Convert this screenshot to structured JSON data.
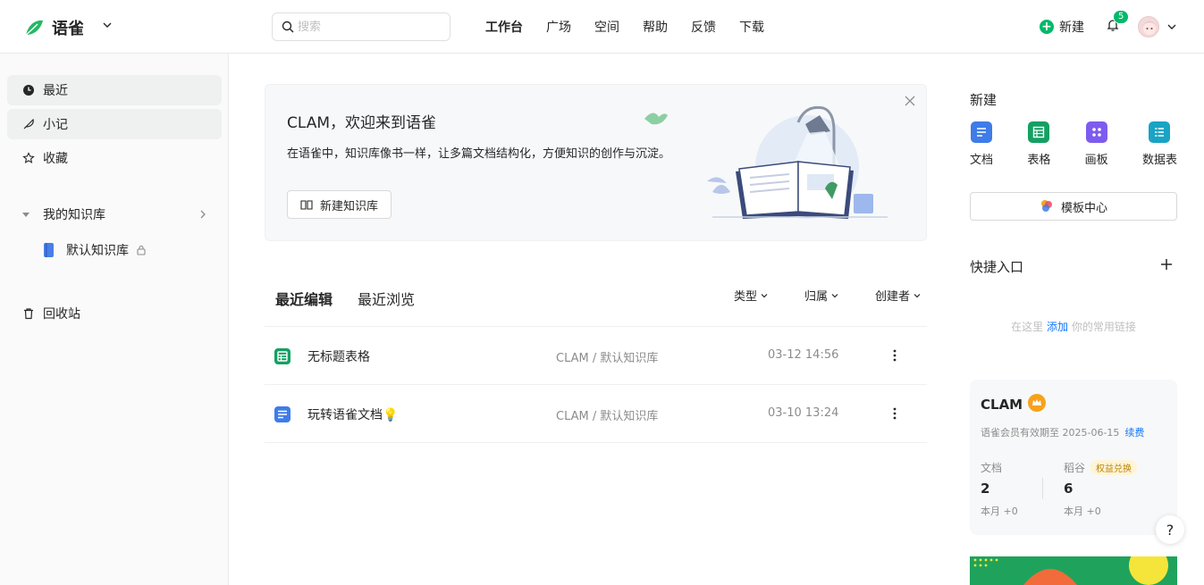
{
  "header": {
    "brand": "语雀",
    "search_placeholder": "搜索",
    "nav": [
      "工作台",
      "广场",
      "空间",
      "帮助",
      "反馈",
      "下载"
    ],
    "new_label": "新建",
    "notification_count": "5"
  },
  "sidebar": {
    "items": [
      {
        "label": "最近",
        "icon": "clock-icon"
      },
      {
        "label": "小记",
        "icon": "feather-icon"
      },
      {
        "label": "收藏",
        "icon": "star-icon"
      }
    ],
    "group_label": "我的知识库",
    "sub_label": "默认知识库",
    "trash_label": "回收站"
  },
  "banner": {
    "title": "CLAM，欢迎来到语雀",
    "desc": "在语雀中，知识库像书一样，让多篇文档结构化，方便知识的创作与沉淀。",
    "button_label": "新建知识库"
  },
  "recent": {
    "tabs": [
      "最近编辑",
      "最近浏览"
    ],
    "filters": [
      "类型",
      "归属",
      "创建者"
    ],
    "rows": [
      {
        "title": "无标题表格",
        "path": "CLAM / 默认知识库",
        "time": "03-12 14:56",
        "type": "sheet"
      },
      {
        "title": "玩转语雀文档💡",
        "path": "CLAM / 默认知识库",
        "time": "03-10 13:24",
        "type": "doc"
      }
    ]
  },
  "right": {
    "new_title": "新建",
    "quick": [
      {
        "label": "文档",
        "color": "#3f7ce8"
      },
      {
        "label": "表格",
        "color": "#13a062"
      },
      {
        "label": "画板",
        "color": "#7e5bef"
      },
      {
        "label": "数据表",
        "color": "#1aa3c4"
      }
    ],
    "template_label": "模板中心",
    "shortcut_title": "快捷入口",
    "shortcut_empty_pre": "在这里",
    "shortcut_empty_link": "添加",
    "shortcut_empty_post": "你的常用链接",
    "member": {
      "name": "CLAM",
      "expire": "语雀会员有效期至 2025-06-15",
      "renew": "续费",
      "stats": [
        {
          "label": "文档",
          "value": "2",
          "month": "本月 +0"
        },
        {
          "label": "稻谷",
          "value": "6",
          "month": "本月 +0",
          "badge": "权益兑换"
        }
      ]
    },
    "help": "?"
  }
}
